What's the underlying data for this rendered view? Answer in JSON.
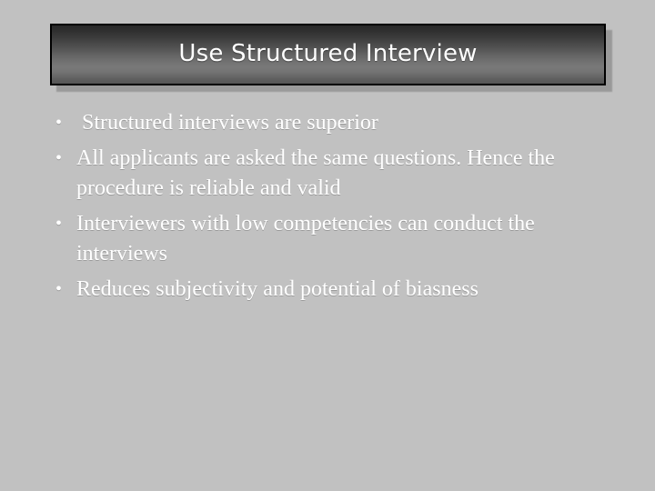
{
  "slide": {
    "background_color": "#c1c1c1",
    "title": {
      "text": "Use Structured Interview",
      "text_color": "#ffffff",
      "box_border_color": "#000000",
      "gradient_top_color": "#272727",
      "gradient_mid_color": "#797979",
      "gradient_bottom_color": "#565656",
      "shadow_color": "#9a9a9a"
    },
    "body": {
      "text_color": "#ffffff",
      "bullet_glyph": "•",
      "bullets": [
        {
          "marker": "•",
          "text": " Structured interviews are superior"
        },
        {
          "marker": "•",
          "text": "All applicants are asked the same questions. Hence the procedure is reliable and valid"
        },
        {
          "marker": "•",
          "text": "Interviewers with low competencies can conduct the interviews"
        },
        {
          "marker": "•",
          "text": "Reduces subjectivity and potential of biasness"
        }
      ]
    }
  }
}
